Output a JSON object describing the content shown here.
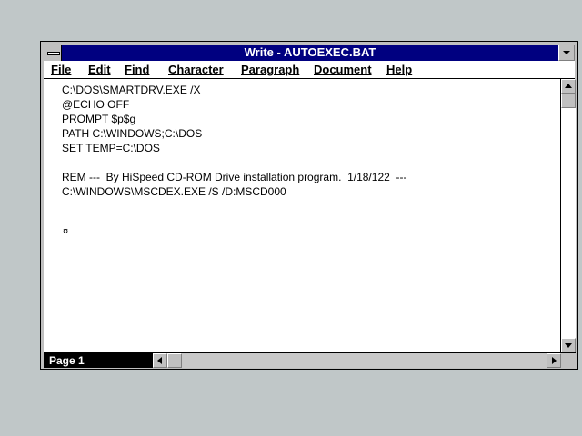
{
  "window": {
    "title": "Write - AUTOEXEC.BAT"
  },
  "menu": {
    "items": [
      {
        "label": "File"
      },
      {
        "label": "Edit"
      },
      {
        "label": "Find"
      },
      {
        "label": "Character"
      },
      {
        "label": "Paragraph"
      },
      {
        "label": "Document"
      },
      {
        "label": "Help"
      }
    ]
  },
  "document": {
    "lines": [
      "C:\\DOS\\SMARTDRV.EXE /X",
      "@ECHO OFF",
      "PROMPT $p$g",
      "PATH C:\\WINDOWS;C:\\DOS",
      "SET TEMP=C:\\DOS",
      "",
      "REM ---  By HiSpeed CD-ROM Drive installation program.  1/18/122  ---",
      "C:\\WINDOWS\\MSCDEX.EXE /S /D:MSCD000"
    ],
    "end_mark": "¤"
  },
  "status": {
    "page": "Page 1"
  },
  "icons": {
    "system_menu": "system-menu-icon",
    "minimize": "minimize-icon",
    "scroll_up": "arrow-up-icon",
    "scroll_down": "arrow-down-icon",
    "scroll_left": "arrow-left-icon",
    "scroll_right": "arrow-right-icon"
  },
  "colors": {
    "titlebar": "#000080",
    "desktop": "#c0c7c8",
    "window_face": "#c0c0c0"
  }
}
